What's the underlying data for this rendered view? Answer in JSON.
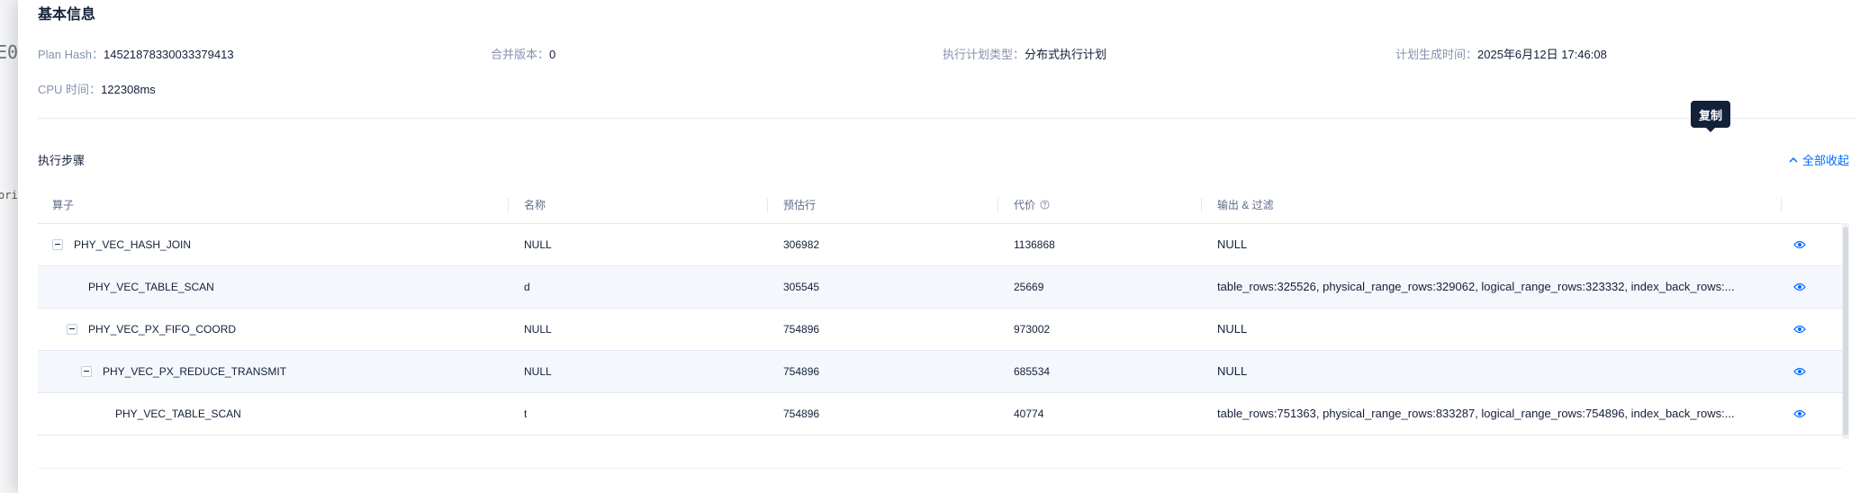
{
  "background": {
    "fragment_e0": "E0",
    "fragment_ori": "ori"
  },
  "basic_info": {
    "title": "基本信息",
    "plan_hash_label": "Plan Hash：",
    "plan_hash_value": "14521878330033379413",
    "merge_version_label": "合并版本：",
    "merge_version_value": "0",
    "plan_type_label": "执行计划类型：",
    "plan_type_value": "分布式执行计划",
    "gen_time_label": "计划生成时间：",
    "gen_time_value": "2025年6月12日 17:46:08",
    "cpu_time_label": "CPU 时间：",
    "cpu_time_value": "122308ms"
  },
  "steps": {
    "title": "执行步骤",
    "collapse_all": "全部收起",
    "tooltip": "复制",
    "columns": {
      "operator": "算子",
      "name": "名称",
      "est_rows": "预估行",
      "cost": "代价",
      "output_filter": "输出 & 过滤"
    },
    "rows": [
      {
        "operator": "PHY_VEC_HASH_JOIN",
        "name": "NULL",
        "est_rows": "306982",
        "cost": "1136868",
        "output": "NULL",
        "toggle": true
      },
      {
        "operator": "PHY_VEC_TABLE_SCAN",
        "name": "d",
        "est_rows": "305545",
        "cost": "25669",
        "output": "table_rows:325526, physical_range_rows:329062, logical_range_rows:323332, index_back_rows:...",
        "toggle": false
      },
      {
        "operator": "PHY_VEC_PX_FIFO_COORD",
        "name": "NULL",
        "est_rows": "754896",
        "cost": "973002",
        "output": "NULL",
        "toggle": true
      },
      {
        "operator": "PHY_VEC_PX_REDUCE_TRANSMIT",
        "name": "NULL",
        "est_rows": "754896",
        "cost": "685534",
        "output": "NULL",
        "toggle": true
      },
      {
        "operator": "PHY_VEC_TABLE_SCAN",
        "name": "t",
        "est_rows": "754896",
        "cost": "40774",
        "output": "table_rows:751363, physical_range_rows:833287, logical_range_rows:754896, index_back_rows:...",
        "toggle": false
      }
    ]
  },
  "icons": {
    "help": "question-circle-icon",
    "view": "eye-icon",
    "collapse": "chevron-up-icon",
    "toggle": "minus-square-icon"
  },
  "colors": {
    "primary": "#006aff",
    "text": "#132039",
    "muted": "#8592ad",
    "tooltip_bg": "#132039"
  }
}
